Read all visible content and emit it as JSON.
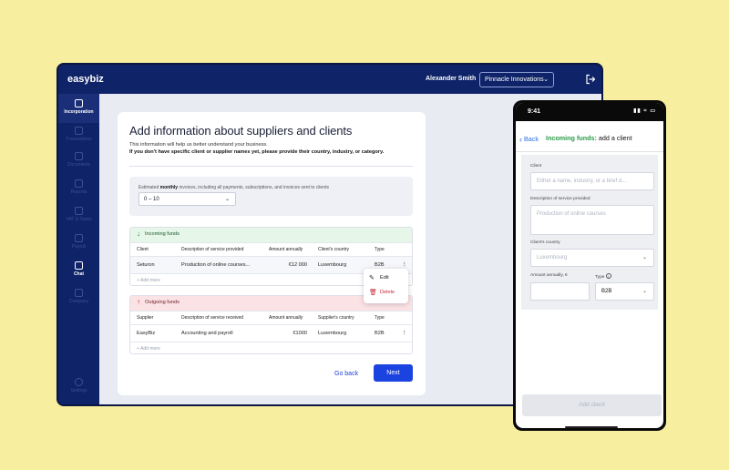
{
  "app": {
    "logo": "easybiz",
    "user_name": "Alexander Smith",
    "company": "Pinnacle Innovations"
  },
  "sidebar": {
    "items": [
      {
        "label": "Incorporation",
        "icon": "building-icon"
      },
      {
        "label": "Transactions",
        "icon": "card-icon"
      },
      {
        "label": "Documents",
        "icon": "folder-icon"
      },
      {
        "label": "Reports",
        "icon": "chart-icon"
      },
      {
        "label": "VAT & Taxes",
        "icon": "tax-icon"
      },
      {
        "label": "Payroll",
        "icon": "people-icon"
      },
      {
        "label": "Chat",
        "icon": "chat-icon"
      },
      {
        "label": "Company",
        "icon": "company-icon"
      },
      {
        "label": "Settings",
        "icon": "gear-icon"
      }
    ]
  },
  "page": {
    "title": "Add information about suppliers and clients",
    "subtitle": "This information will help us better understand your business.",
    "subtitle_bold": "If you don't have specific client or supplier names yet, please provide their country, industry, or category.",
    "estimate_label_pre": "Estimated ",
    "estimate_label_bold": "monthly",
    "estimate_label_post": " invoices, including all payments, subscriptions, and invoices sent to clients",
    "estimate_value": "0 – 10",
    "go_back": "Go back",
    "next": "Next"
  },
  "incoming": {
    "title": "Incoming funds",
    "columns": [
      "Client",
      "Description of service provided",
      "Amount annually",
      "Client's country",
      "Type"
    ],
    "rows": [
      {
        "name": "Seturon",
        "description": "Production of online courses...",
        "amount": "€12 000",
        "country": "Luxembourg",
        "type": "B2B"
      }
    ],
    "add_more": "Add more"
  },
  "outgoing": {
    "title": "Outgoing funds",
    "columns": [
      "Supplier",
      "Description of service received",
      "Amount annually",
      "Supplier's country",
      "Type"
    ],
    "rows": [
      {
        "name": "EasyBiz",
        "description": "Accounting and payroll",
        "amount": "€1000",
        "country": "Luxembourg",
        "type": "B2B"
      }
    ],
    "add_more": "Add more"
  },
  "context_menu": {
    "edit": "Edit",
    "delete": "Delete"
  },
  "phone": {
    "time": "9:41",
    "back": "Back",
    "title_highlight": "Incoming funds:",
    "title_rest": " add a client",
    "client_label": "Client",
    "client_placeholder": "Either a name, industry, or a brief d...",
    "description_label": "Description of service provided",
    "description_placeholder": "Production of online courses",
    "country_label": "Client's country",
    "country_value": "Luxembourg",
    "amount_label": "Amount annually, €",
    "type_label": "Type",
    "type_value": "B2B",
    "add_button": "Add client"
  }
}
